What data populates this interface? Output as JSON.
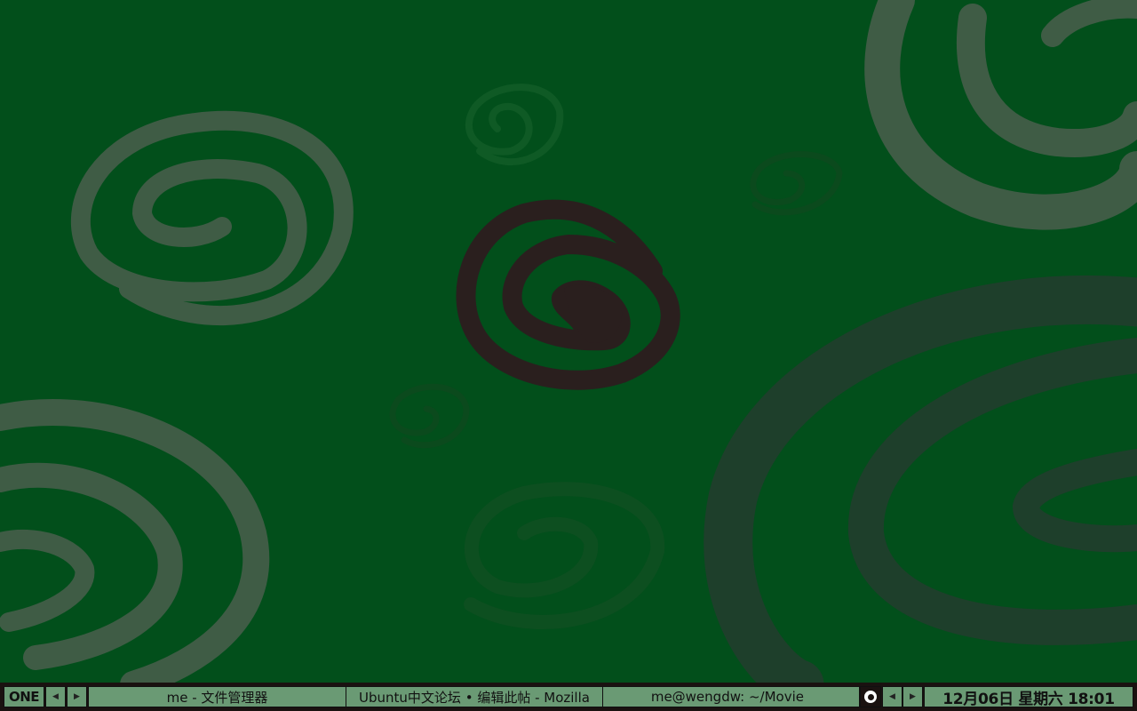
{
  "panel": {
    "workspace": "ONE",
    "prev_icon": "triangle-left-icon",
    "next_icon": "triangle-right-icon",
    "prev_glyph": "◀",
    "next_glyph": "▶",
    "tasks": [
      {
        "title": "me - 文件管理器"
      },
      {
        "title": "Ubuntu中文论坛 • 编辑此帖 - Mozilla"
      },
      {
        "title": "me@wengdw: ~/Movie"
      }
    ],
    "menu_icon": "circle-menu-icon",
    "clock": "12月06日 星期六 18:01"
  },
  "colors": {
    "desktop": "#024f1b",
    "panel_bg": "#1a1210",
    "cell_bg": "#6a9a74",
    "swirl_main": "#2a1f1e",
    "swirl_light": "#3f5c45"
  }
}
